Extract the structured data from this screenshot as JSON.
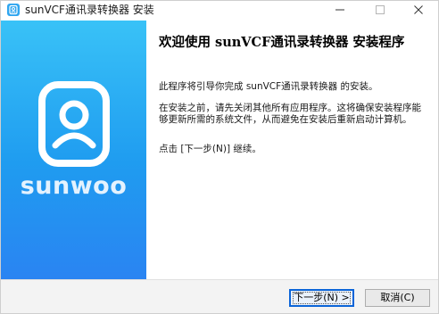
{
  "window": {
    "title": "sunVCF通讯录转换器 安装",
    "accent_color": "#1f9cf0"
  },
  "banner": {
    "brand": "sunwoo",
    "logo_icon": "contact-card-icon"
  },
  "content": {
    "heading": "欢迎使用 sunVCF通讯录转换器 安装程序",
    "paragraph1": "此程序将引导你完成 sunVCF通讯录转换器 的安装。",
    "paragraph2": "在安装之前，请先关闭其他所有应用程序。这将确保安装程序能够更新所需的系统文件，从而避免在安装后重新启动计算机。",
    "paragraph3": "点击 [下一步(N)] 继续。"
  },
  "buttons": {
    "next": "下一步(N) >",
    "cancel": "取消(C)"
  }
}
